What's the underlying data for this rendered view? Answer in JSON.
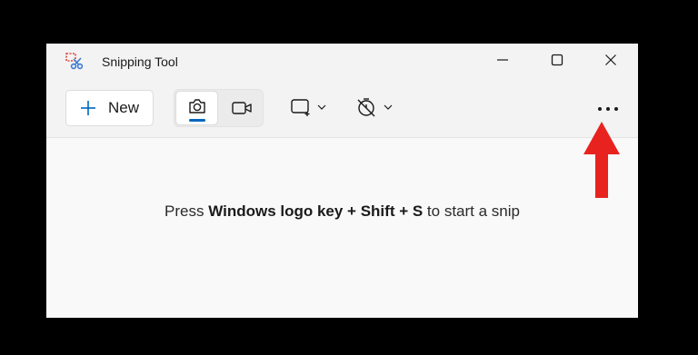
{
  "window": {
    "title": "Snipping Tool",
    "caption_buttons": [
      "minimize-icon",
      "maximize-icon",
      "close-icon"
    ]
  },
  "toolbar": {
    "new_label": "New",
    "new_icon": "plus-icon",
    "modes": [
      {
        "name": "snip",
        "icon": "camera-icon",
        "selected": true
      },
      {
        "name": "record",
        "icon": "video-camera-icon",
        "selected": false
      }
    ],
    "snip_mode_icon": "rectangle-snip-icon",
    "delay_icon": "timer-off-icon",
    "more_icon": "more-horizontal-icon"
  },
  "content": {
    "hint_prefix": "Press ",
    "hint_keys": "Windows logo key + Shift + S",
    "hint_suffix": " to start a snip"
  },
  "colors": {
    "accent": "#0067c0",
    "annotation_arrow": "#e8231f"
  }
}
